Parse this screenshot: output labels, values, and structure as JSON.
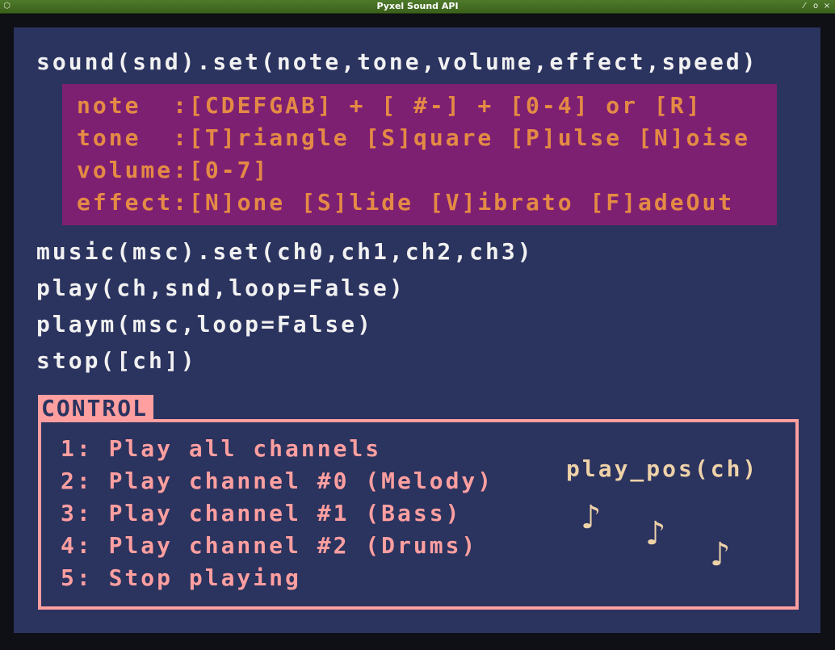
{
  "window": {
    "title": "Pyxel Sound API",
    "app_icon": "cube-icon",
    "controls": [
      "pin-icon",
      "maximize-icon",
      "close-icon"
    ],
    "control_glyphs": [
      "⁄",
      "o",
      "×"
    ]
  },
  "api": {
    "sound_set": "sound(snd).set(note,tone,volume,effect,speed)",
    "params": {
      "note": "note  :[CDEFGAB] + [ #-] + [0-4] or [R]",
      "tone": "tone  :[T]riangle [S]quare [P]ulse [N]oise",
      "volume": "volume:[0-7]",
      "effect": "effect:[N]one [S]lide [V]ibrato [F]adeOut"
    },
    "music_set": "music(msc).set(ch0,ch1,ch2,ch3)",
    "play": "play(ch,snd,loop=False)",
    "playm": "playm(msc,loop=False)",
    "stop": "stop([ch])"
  },
  "control": {
    "tab_label": "CONTROL",
    "items": [
      "1: Play all channels",
      "2: Play channel #0 (Melody)",
      "3: Play channel #1 (Bass)",
      "4: Play channel #2 (Drums)",
      "5: Stop playing"
    ],
    "play_pos_label": "play_pos(ch)",
    "note_icon_glyph": "♪"
  },
  "colors": {
    "background": "#2b335f",
    "titlebar": "#4f7a2a",
    "text_white": "#f1f1f1",
    "note_box": "#7e2072",
    "note_text": "#e48a45",
    "control": "#ff9fa0",
    "cream": "#eed2a8"
  }
}
